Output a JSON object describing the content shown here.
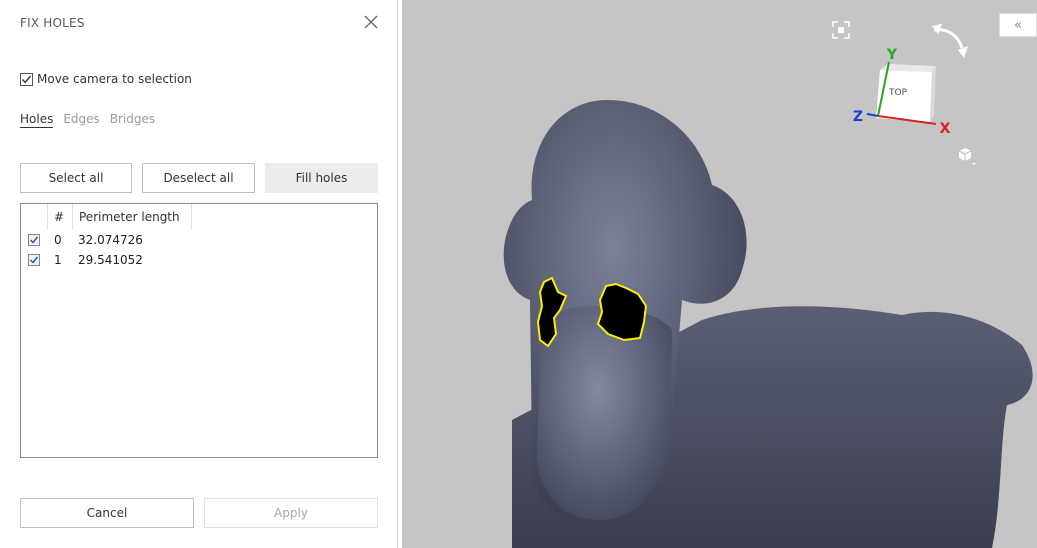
{
  "panel": {
    "title": "FIX HOLES",
    "close_icon": "close-icon",
    "move_camera": {
      "label": "Move camera to selection",
      "checked": true
    },
    "tabs": [
      {
        "label": "Holes",
        "active": true
      },
      {
        "label": "Edges",
        "active": false
      },
      {
        "label": "Bridges",
        "active": false
      }
    ],
    "buttons": {
      "select_all": "Select all",
      "deselect_all": "Deselect all",
      "fill_holes": "Fill holes"
    },
    "table": {
      "columns": [
        "#",
        "Perimeter length"
      ],
      "rows": [
        {
          "index": "0",
          "perimeter": "32.074726",
          "checked": true
        },
        {
          "index": "1",
          "perimeter": "29.541052",
          "checked": true
        }
      ]
    },
    "footer": {
      "cancel": "Cancel",
      "apply": "Apply"
    }
  },
  "viewport": {
    "background": "#c5c5c5",
    "model_color": "#4a4e60",
    "hole_outline_color": "#ffee00",
    "view_cube": {
      "face_label": "TOP",
      "axes": [
        {
          "label": "Y",
          "color": "#22aa22"
        },
        {
          "label": "Z",
          "color": "#1a3fd6"
        },
        {
          "label": "X",
          "color": "#d62222"
        }
      ]
    },
    "icons": [
      "fit-view-icon",
      "rotate-view-icon",
      "view-mode-icon",
      "collapse-panel-icon"
    ],
    "collapse_label": "«"
  }
}
